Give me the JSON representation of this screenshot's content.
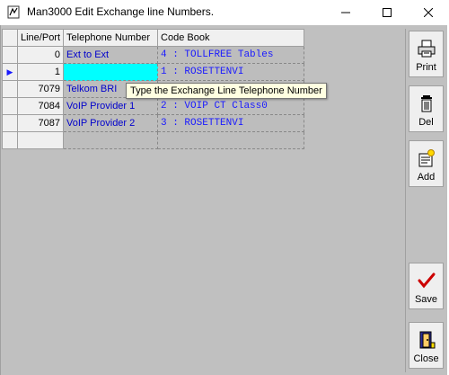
{
  "window": {
    "title": "Man3000 Edit Exchange line Numbers."
  },
  "grid": {
    "headers": {
      "port": "Line/Port",
      "phone": "Telephone Number",
      "code": "Code Book"
    },
    "rows": [
      {
        "port": "0",
        "phone": "Ext to Ext",
        "code": "4 : TOLLFREE Tables"
      },
      {
        "port": "1",
        "phone": "",
        "code": "1 : ROSETTENVI"
      },
      {
        "port": "7079",
        "phone": "Telkom BRI",
        "code": ""
      },
      {
        "port": "7084",
        "phone": "VoIP Provider 1",
        "code": "2 : VOIP CT Class0"
      },
      {
        "port": "7087",
        "phone": "VoIP Provider 2",
        "code": "3 : ROSETTENVI"
      },
      {
        "port": "",
        "phone": "",
        "code": ""
      }
    ]
  },
  "tooltip": "Type the Exchange Line Telephone Number",
  "toolbar": {
    "print": "Print",
    "del": "Del",
    "add": "Add",
    "save": "Save",
    "close": "Close"
  }
}
